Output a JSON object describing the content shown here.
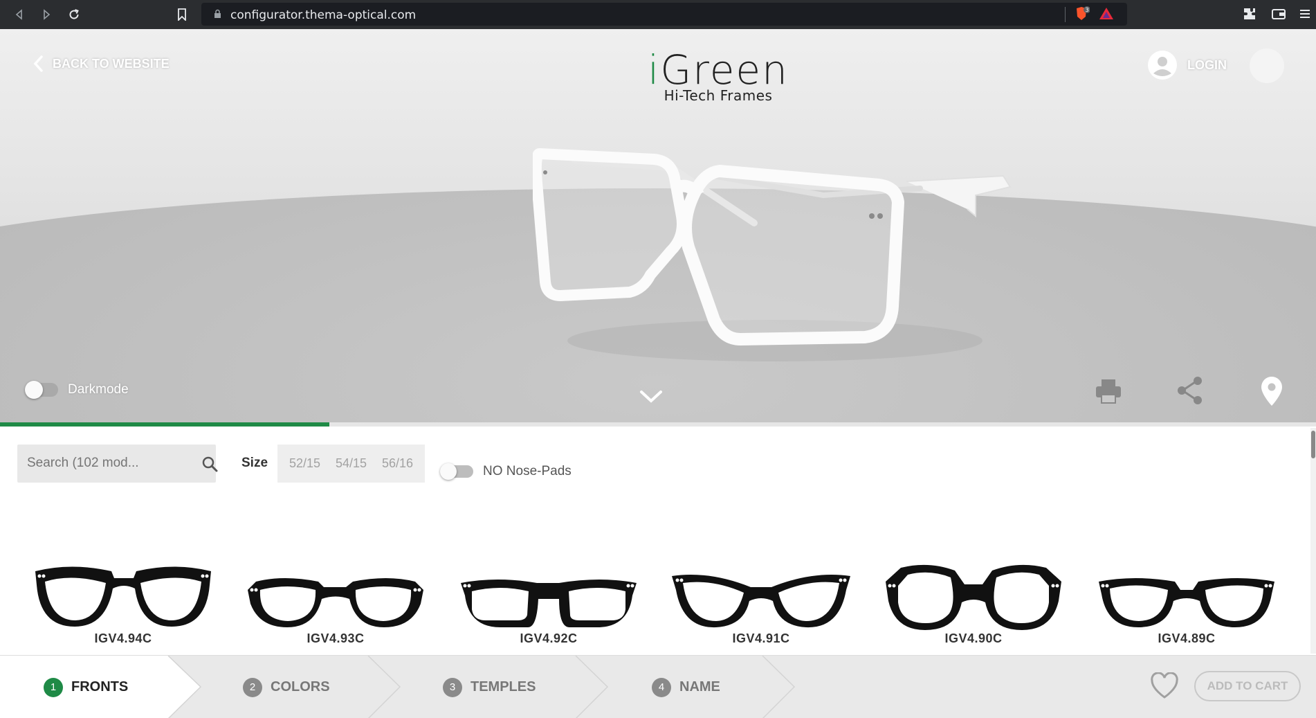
{
  "browser": {
    "url": "configurator.thema-optical.com",
    "extension_badge": "3"
  },
  "hero": {
    "back_label": "BACK TO WEBSITE",
    "brand_initial": "i",
    "brand_rest": "Green",
    "brand_tagline": "Hi-Tech Frames",
    "login_label": "LOGIN",
    "darkmode_label": "Darkmode",
    "darkmode_on": false,
    "progress_fraction": 0.25
  },
  "filters": {
    "search_placeholder": "Search (102 mod...",
    "size_label": "Size",
    "sizes": [
      "52/15",
      "54/15",
      "56/16"
    ],
    "nosepads_label": "NO Nose-Pads",
    "nosepads_on": false
  },
  "products": [
    {
      "code": "IGV4.94C"
    },
    {
      "code": "IGV4.93C"
    },
    {
      "code": "IGV4.92C"
    },
    {
      "code": "IGV4.91C"
    },
    {
      "code": "IGV4.90C"
    },
    {
      "code": "IGV4.89C"
    }
  ],
  "stepper": {
    "steps": [
      {
        "num": "1",
        "label": "FRONTS",
        "active": true
      },
      {
        "num": "2",
        "label": "COLORS",
        "active": false
      },
      {
        "num": "3",
        "label": "TEMPLES",
        "active": false
      },
      {
        "num": "4",
        "label": "NAME",
        "active": false
      }
    ],
    "cart_label": "ADD TO CART"
  },
  "colors": {
    "accent": "#1f8a46",
    "chrome": "#2b2d30"
  }
}
